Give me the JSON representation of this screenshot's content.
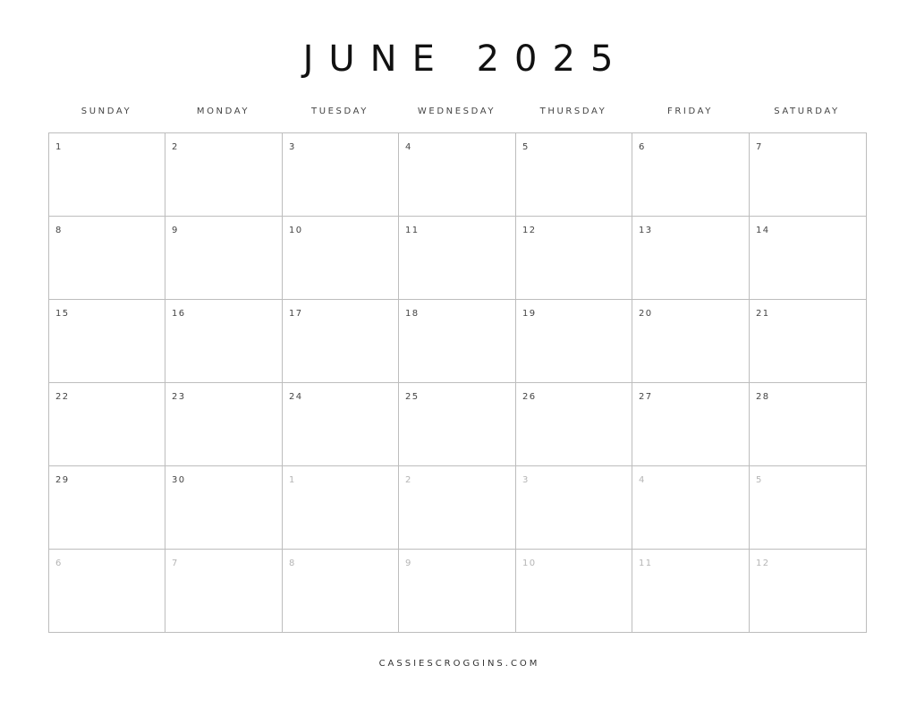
{
  "calendar": {
    "title": "JUNE 2025",
    "weekdays": [
      "SUNDAY",
      "MONDAY",
      "TUESDAY",
      "WEDNESDAY",
      "THURSDAY",
      "FRIDAY",
      "SATURDAY"
    ],
    "weeks": [
      [
        {
          "day": "1",
          "in_month": true
        },
        {
          "day": "2",
          "in_month": true
        },
        {
          "day": "3",
          "in_month": true
        },
        {
          "day": "4",
          "in_month": true
        },
        {
          "day": "5",
          "in_month": true
        },
        {
          "day": "6",
          "in_month": true
        },
        {
          "day": "7",
          "in_month": true
        }
      ],
      [
        {
          "day": "8",
          "in_month": true
        },
        {
          "day": "9",
          "in_month": true
        },
        {
          "day": "10",
          "in_month": true
        },
        {
          "day": "11",
          "in_month": true
        },
        {
          "day": "12",
          "in_month": true
        },
        {
          "day": "13",
          "in_month": true
        },
        {
          "day": "14",
          "in_month": true
        }
      ],
      [
        {
          "day": "15",
          "in_month": true
        },
        {
          "day": "16",
          "in_month": true
        },
        {
          "day": "17",
          "in_month": true
        },
        {
          "day": "18",
          "in_month": true
        },
        {
          "day": "19",
          "in_month": true
        },
        {
          "day": "20",
          "in_month": true
        },
        {
          "day": "21",
          "in_month": true
        }
      ],
      [
        {
          "day": "22",
          "in_month": true
        },
        {
          "day": "23",
          "in_month": true
        },
        {
          "day": "24",
          "in_month": true
        },
        {
          "day": "25",
          "in_month": true
        },
        {
          "day": "26",
          "in_month": true
        },
        {
          "day": "27",
          "in_month": true
        },
        {
          "day": "28",
          "in_month": true
        }
      ],
      [
        {
          "day": "29",
          "in_month": true
        },
        {
          "day": "30",
          "in_month": true
        },
        {
          "day": "1",
          "in_month": false
        },
        {
          "day": "2",
          "in_month": false
        },
        {
          "day": "3",
          "in_month": false
        },
        {
          "day": "4",
          "in_month": false
        },
        {
          "day": "5",
          "in_month": false
        }
      ],
      [
        {
          "day": "6",
          "in_month": false
        },
        {
          "day": "7",
          "in_month": false
        },
        {
          "day": "8",
          "in_month": false
        },
        {
          "day": "9",
          "in_month": false
        },
        {
          "day": "10",
          "in_month": false
        },
        {
          "day": "11",
          "in_month": false
        },
        {
          "day": "12",
          "in_month": false
        }
      ]
    ]
  },
  "footer": {
    "text": "CASSIESCROGGINS.COM"
  },
  "colors": {
    "text": "#111111",
    "label": "#444444",
    "muted_day": "#b5b5b5",
    "grid_line": "#bdbdbd",
    "background": "#ffffff"
  }
}
